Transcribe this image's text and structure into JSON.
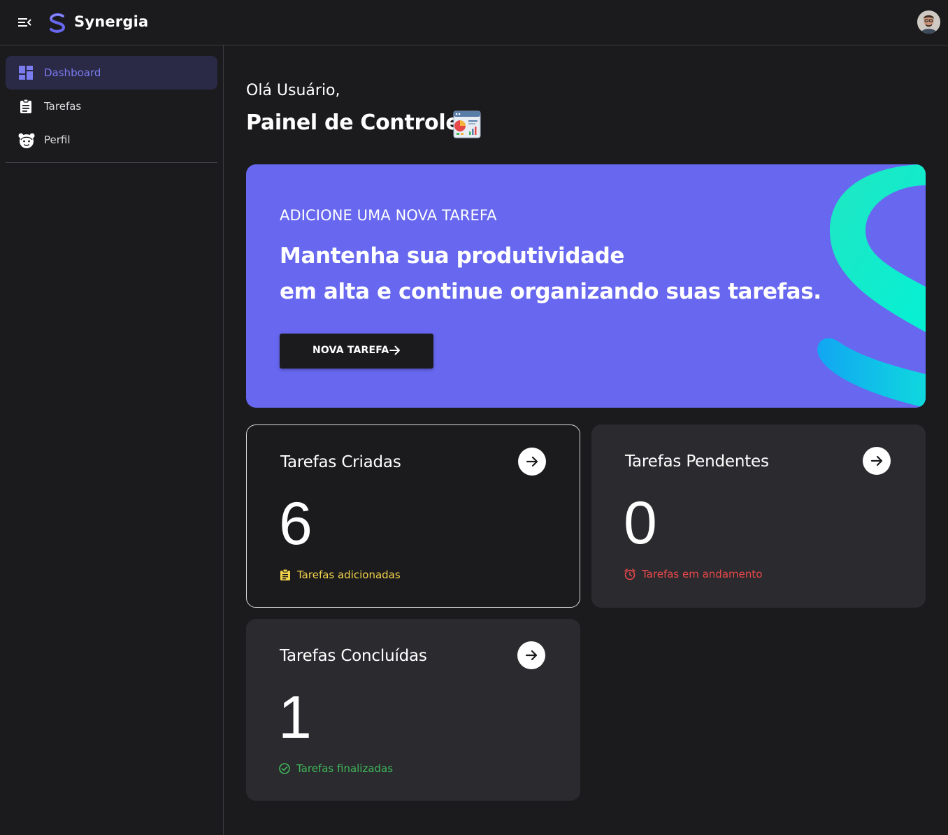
{
  "header": {
    "brand": "Synergia",
    "menu_icon": "menu-collapse-icon",
    "logo_icon": "synergia-logo-icon",
    "avatar_icon": "user-avatar"
  },
  "sidebar": {
    "items": [
      {
        "label": "Dashboard",
        "icon": "dashboard-icon",
        "active": true
      },
      {
        "label": "Tarefas",
        "icon": "clipboard-icon",
        "active": false
      },
      {
        "label": "Perfil",
        "icon": "face-icon",
        "active": false
      }
    ]
  },
  "main": {
    "greeting": "Olá Usuário,",
    "title": "Painel de Controle",
    "title_icon": "dashboard-chart-icon"
  },
  "banner": {
    "eyebrow": "ADICIONE UMA NOVA TAREFA",
    "line1": "Mantenha sua produtividade",
    "line2": "em alta e continue organizando suas tarefas.",
    "button_label": "NOVA TAREFA",
    "button_icon": "arrow-right-icon",
    "background_color": "#6767ef"
  },
  "cards": [
    {
      "title": "Tarefas Criadas",
      "value": "6",
      "foot_label": "Tarefas adicionadas",
      "foot_icon": "clipboard-icon",
      "foot_color": "#f3d34a"
    },
    {
      "title": "Tarefas Pendentes",
      "value": "0",
      "foot_label": "Tarefas em andamento",
      "foot_icon": "alarm-clock-icon",
      "foot_color": "#e8474a"
    },
    {
      "title": "Tarefas Concluídas",
      "value": "1",
      "foot_label": "Tarefas finalizadas",
      "foot_icon": "check-circle-icon",
      "foot_color": "#3fb85a"
    }
  ],
  "colors": {
    "accent": "#7b7cf0",
    "background": "#1b1b1e",
    "card": "#2b2b2f"
  }
}
